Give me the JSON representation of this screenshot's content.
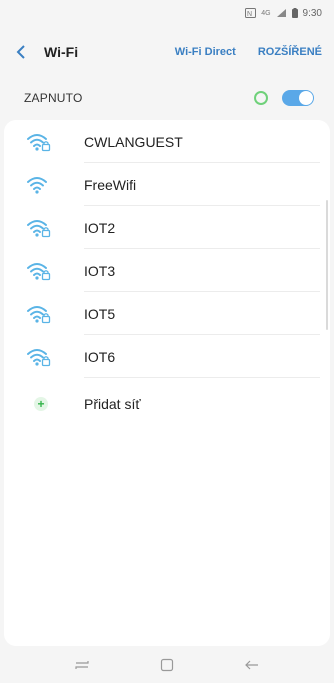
{
  "status_bar": {
    "time": "9:30",
    "icons": [
      "nfc-icon",
      "data-4g-icon",
      "signal-icon",
      "battery-icon"
    ],
    "data_label": "4G"
  },
  "header": {
    "title": "Wi-Fi",
    "wifi_direct": "Wi-Fi Direct",
    "advanced": "ROZŠÍŘENÉ"
  },
  "toggle": {
    "label": "ZAPNUTO",
    "on": true
  },
  "networks": [
    {
      "name": "CWLANGUEST",
      "secured": true
    },
    {
      "name": "FreeWifi",
      "secured": false
    },
    {
      "name": "IOT2",
      "secured": true
    },
    {
      "name": "IOT3",
      "secured": true
    },
    {
      "name": "IOT5",
      "secured": true
    },
    {
      "name": "IOT6",
      "secured": true
    }
  ],
  "add_network": {
    "label": "Přidat síť"
  },
  "navbar": {
    "icons": [
      "recent-apps-icon",
      "home-icon",
      "back-nav-icon"
    ]
  },
  "colors": {
    "accent": "#3a7fc2",
    "wifi_icon": "#5ab4e6",
    "toggle_on": "#5aa8e8",
    "status_ring": "#6fd17a",
    "add_icon": "#34b44a"
  }
}
